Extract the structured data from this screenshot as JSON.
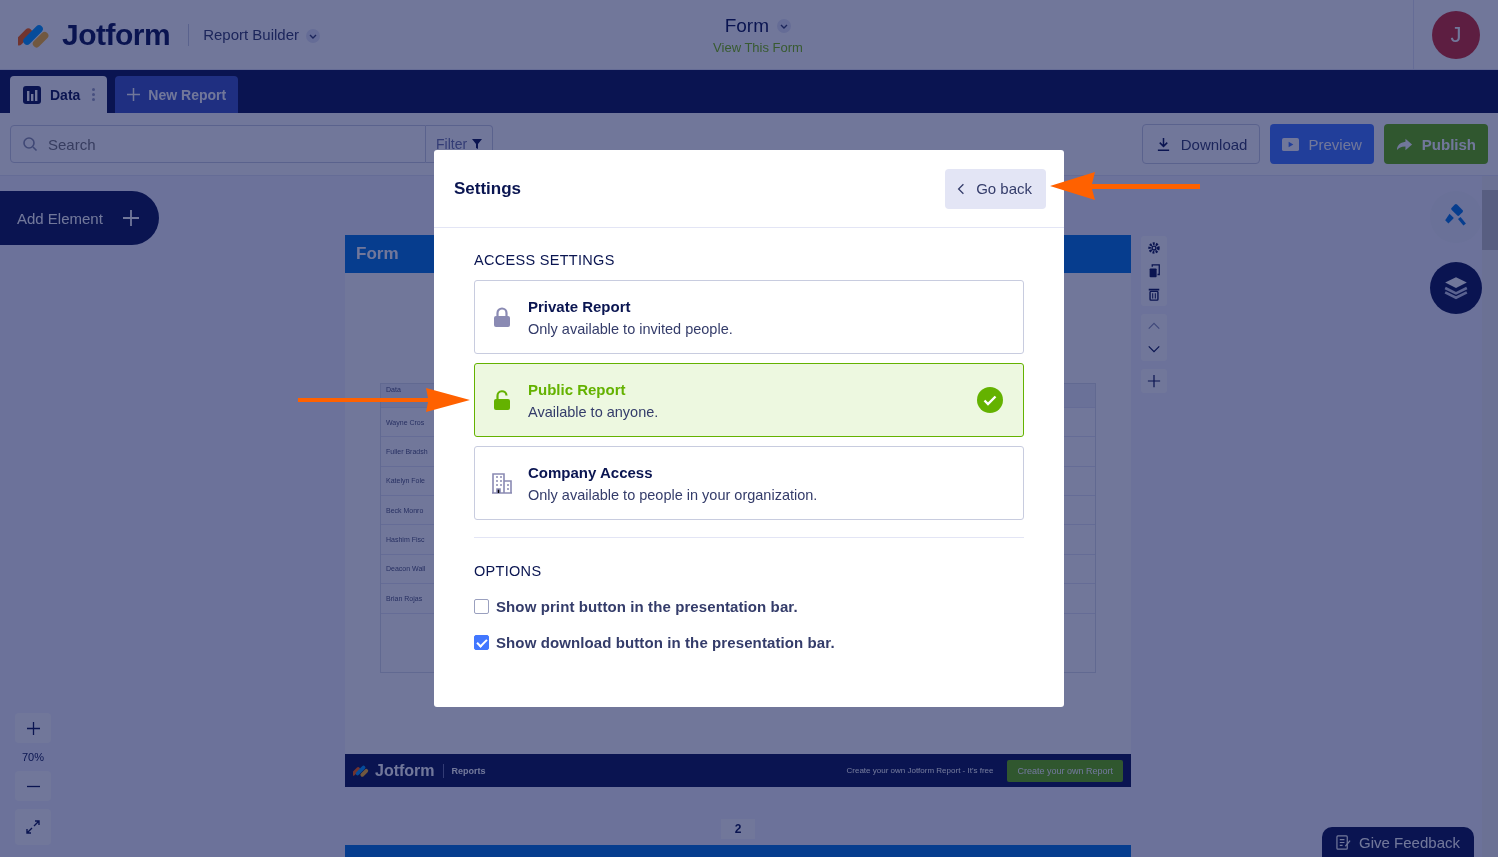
{
  "header": {
    "logo": "Jotform",
    "product": "Report Builder",
    "form_title": "Form",
    "form_link": "View This Form",
    "avatar": "J"
  },
  "tabs": [
    {
      "label": "Data",
      "kind": "data",
      "selected": true
    },
    {
      "label": "New Report",
      "kind": "new",
      "selected": false
    }
  ],
  "toolbar": {
    "search": {
      "placeholder": "Search"
    },
    "filter": "Filter",
    "buttons": [
      {
        "label": "Download",
        "kind": "download"
      },
      {
        "label": "Preview",
        "kind": "preview"
      },
      {
        "label": "Publish",
        "kind": "publish"
      }
    ]
  },
  "sidebar": {
    "add_element": "Add Element",
    "zoom": "70%"
  },
  "page": {
    "title": "Form",
    "table": {
      "header": "Data",
      "rows": [
        "Wayne Cros",
        "Fuller Bradsh",
        "Katelyn Fole",
        "Beck Monro",
        "Hashim Fisc",
        "Deacon Wall",
        "Brian Rojas"
      ]
    },
    "footer": {
      "logo": "Jotform",
      "label": "Reports",
      "promo": "Create your own Jotform Report - It's free",
      "cta": "Create your own Report"
    },
    "next_page": "2"
  },
  "feedback": "Give Feedback",
  "modal": {
    "title": "Settings",
    "back": "Go back",
    "access_heading": "ACCESS SETTINGS",
    "access_options": [
      {
        "kind": "private",
        "title": "Private Report",
        "description": "Only available to invited people.",
        "selected": false
      },
      {
        "kind": "public",
        "title": "Public Report",
        "description": "Available to anyone.",
        "selected": true
      },
      {
        "kind": "company",
        "title": "Company Access",
        "description": "Only available to people in your organization.",
        "selected": false
      }
    ],
    "options_heading": "OPTIONS",
    "options": [
      {
        "label": "Show print button in the presentation bar.",
        "checked": false
      },
      {
        "label": "Show download button in the presentation bar.",
        "checked": true
      }
    ]
  }
}
